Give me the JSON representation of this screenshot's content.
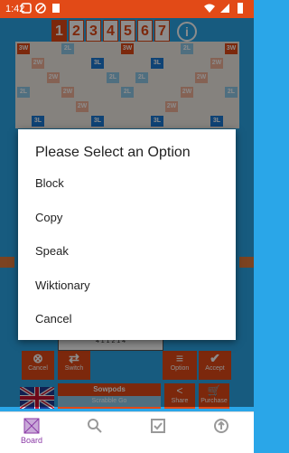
{
  "status": {
    "time": "1:42"
  },
  "tiles": [
    "1",
    "2",
    "3",
    "4",
    "5",
    "6",
    "7"
  ],
  "info_label": "i",
  "dialog": {
    "title": "Please Select an Option",
    "options": [
      "Block",
      "Copy",
      "Speak",
      "Wiktionary",
      "Cancel"
    ]
  },
  "rack_text": "4   1   1   2   1   4",
  "buttons": {
    "cancel": "Cancel",
    "switch": "Switch",
    "option": "Option",
    "accept": "Accept"
  },
  "dictionary": {
    "name": "Sowpods",
    "mode": "Scrabble Go"
  },
  "share": "Share",
  "purchase": "Purchase",
  "nav": {
    "board": "Board"
  },
  "colors": {
    "primary": "#e24a17",
    "background": "#2aa6e8",
    "nav_active": "#8b3aa6"
  },
  "board_labels": {
    "w3": "3W",
    "w2": "2W",
    "l3": "3L",
    "l2": "2L"
  }
}
